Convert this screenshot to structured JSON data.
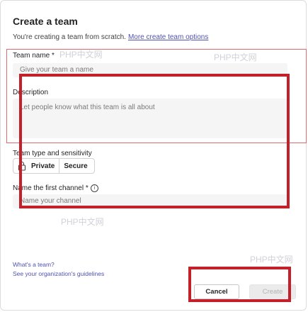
{
  "dialog": {
    "title": "Create a team",
    "subtitle": "You're creating a team from scratch.",
    "subtitle_link": "More create team options"
  },
  "team_name": {
    "label": "Team name *",
    "placeholder": "Give your team a name"
  },
  "description": {
    "label": "Description",
    "placeholder": "Let people know what this team is all about"
  },
  "team_type": {
    "label": "Team type and sensitivity",
    "privacy": "Private",
    "sensitivity": "Secure",
    "icon": "lock-icon"
  },
  "channel": {
    "label": "Name the first channel *",
    "placeholder": "Name your channel",
    "icon": "info-icon"
  },
  "links": {
    "whats_a_team": "What's a team?",
    "guidelines": "See your organization's guidelines"
  },
  "buttons": {
    "cancel": "Cancel",
    "create": "Create"
  },
  "watermarks": [
    "PHP中文网",
    "PHP中文网",
    "PHP中文网",
    "PHP中文网"
  ],
  "colors": {
    "accent": "#4f52b2",
    "highlight": "#c4202b"
  }
}
